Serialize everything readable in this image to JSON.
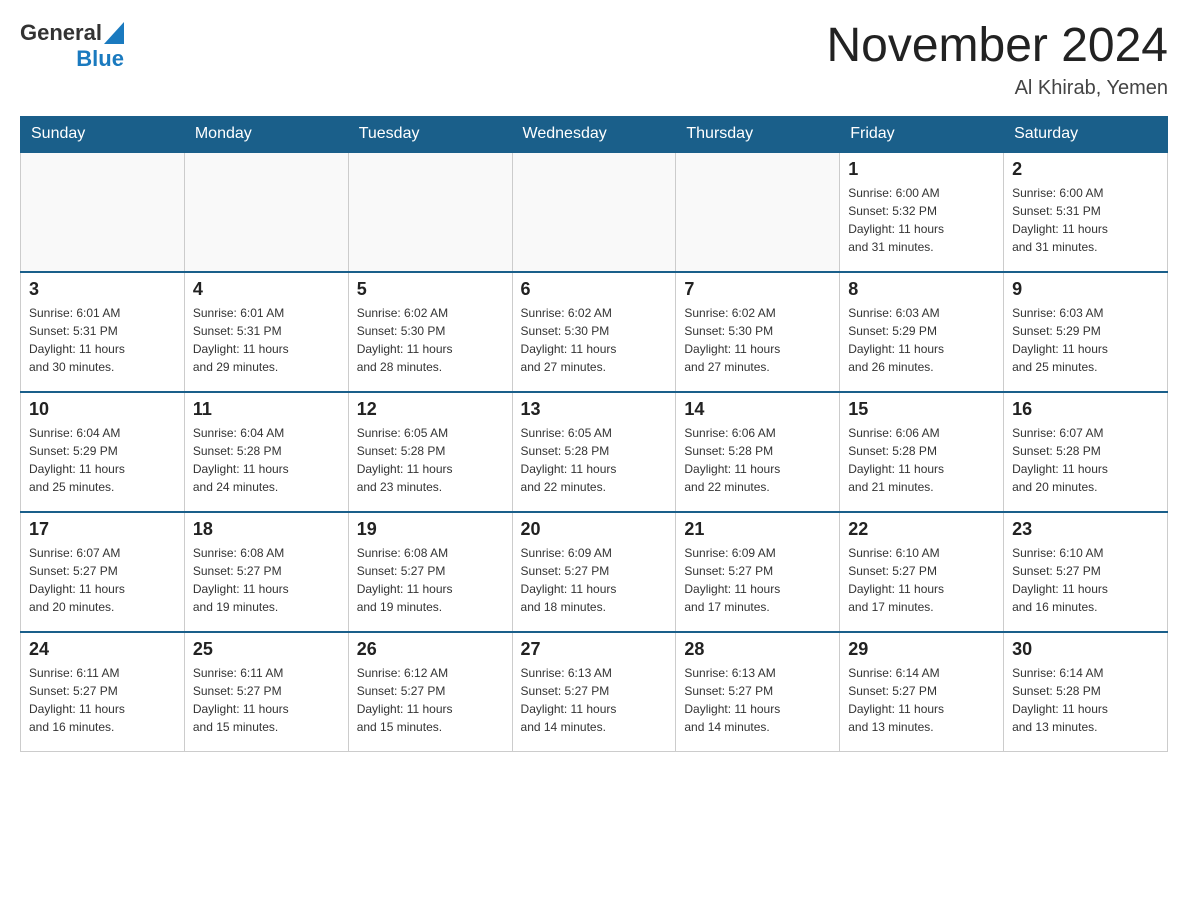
{
  "header": {
    "logo_general": "General",
    "logo_blue": "Blue",
    "title": "November 2024",
    "subtitle": "Al Khirab, Yemen"
  },
  "weekdays": [
    "Sunday",
    "Monday",
    "Tuesday",
    "Wednesday",
    "Thursday",
    "Friday",
    "Saturday"
  ],
  "weeks": [
    [
      {
        "day": "",
        "info": ""
      },
      {
        "day": "",
        "info": ""
      },
      {
        "day": "",
        "info": ""
      },
      {
        "day": "",
        "info": ""
      },
      {
        "day": "",
        "info": ""
      },
      {
        "day": "1",
        "info": "Sunrise: 6:00 AM\nSunset: 5:32 PM\nDaylight: 11 hours\nand 31 minutes."
      },
      {
        "day": "2",
        "info": "Sunrise: 6:00 AM\nSunset: 5:31 PM\nDaylight: 11 hours\nand 31 minutes."
      }
    ],
    [
      {
        "day": "3",
        "info": "Sunrise: 6:01 AM\nSunset: 5:31 PM\nDaylight: 11 hours\nand 30 minutes."
      },
      {
        "day": "4",
        "info": "Sunrise: 6:01 AM\nSunset: 5:31 PM\nDaylight: 11 hours\nand 29 minutes."
      },
      {
        "day": "5",
        "info": "Sunrise: 6:02 AM\nSunset: 5:30 PM\nDaylight: 11 hours\nand 28 minutes."
      },
      {
        "day": "6",
        "info": "Sunrise: 6:02 AM\nSunset: 5:30 PM\nDaylight: 11 hours\nand 27 minutes."
      },
      {
        "day": "7",
        "info": "Sunrise: 6:02 AM\nSunset: 5:30 PM\nDaylight: 11 hours\nand 27 minutes."
      },
      {
        "day": "8",
        "info": "Sunrise: 6:03 AM\nSunset: 5:29 PM\nDaylight: 11 hours\nand 26 minutes."
      },
      {
        "day": "9",
        "info": "Sunrise: 6:03 AM\nSunset: 5:29 PM\nDaylight: 11 hours\nand 25 minutes."
      }
    ],
    [
      {
        "day": "10",
        "info": "Sunrise: 6:04 AM\nSunset: 5:29 PM\nDaylight: 11 hours\nand 25 minutes."
      },
      {
        "day": "11",
        "info": "Sunrise: 6:04 AM\nSunset: 5:28 PM\nDaylight: 11 hours\nand 24 minutes."
      },
      {
        "day": "12",
        "info": "Sunrise: 6:05 AM\nSunset: 5:28 PM\nDaylight: 11 hours\nand 23 minutes."
      },
      {
        "day": "13",
        "info": "Sunrise: 6:05 AM\nSunset: 5:28 PM\nDaylight: 11 hours\nand 22 minutes."
      },
      {
        "day": "14",
        "info": "Sunrise: 6:06 AM\nSunset: 5:28 PM\nDaylight: 11 hours\nand 22 minutes."
      },
      {
        "day": "15",
        "info": "Sunrise: 6:06 AM\nSunset: 5:28 PM\nDaylight: 11 hours\nand 21 minutes."
      },
      {
        "day": "16",
        "info": "Sunrise: 6:07 AM\nSunset: 5:28 PM\nDaylight: 11 hours\nand 20 minutes."
      }
    ],
    [
      {
        "day": "17",
        "info": "Sunrise: 6:07 AM\nSunset: 5:27 PM\nDaylight: 11 hours\nand 20 minutes."
      },
      {
        "day": "18",
        "info": "Sunrise: 6:08 AM\nSunset: 5:27 PM\nDaylight: 11 hours\nand 19 minutes."
      },
      {
        "day": "19",
        "info": "Sunrise: 6:08 AM\nSunset: 5:27 PM\nDaylight: 11 hours\nand 19 minutes."
      },
      {
        "day": "20",
        "info": "Sunrise: 6:09 AM\nSunset: 5:27 PM\nDaylight: 11 hours\nand 18 minutes."
      },
      {
        "day": "21",
        "info": "Sunrise: 6:09 AM\nSunset: 5:27 PM\nDaylight: 11 hours\nand 17 minutes."
      },
      {
        "day": "22",
        "info": "Sunrise: 6:10 AM\nSunset: 5:27 PM\nDaylight: 11 hours\nand 17 minutes."
      },
      {
        "day": "23",
        "info": "Sunrise: 6:10 AM\nSunset: 5:27 PM\nDaylight: 11 hours\nand 16 minutes."
      }
    ],
    [
      {
        "day": "24",
        "info": "Sunrise: 6:11 AM\nSunset: 5:27 PM\nDaylight: 11 hours\nand 16 minutes."
      },
      {
        "day": "25",
        "info": "Sunrise: 6:11 AM\nSunset: 5:27 PM\nDaylight: 11 hours\nand 15 minutes."
      },
      {
        "day": "26",
        "info": "Sunrise: 6:12 AM\nSunset: 5:27 PM\nDaylight: 11 hours\nand 15 minutes."
      },
      {
        "day": "27",
        "info": "Sunrise: 6:13 AM\nSunset: 5:27 PM\nDaylight: 11 hours\nand 14 minutes."
      },
      {
        "day": "28",
        "info": "Sunrise: 6:13 AM\nSunset: 5:27 PM\nDaylight: 11 hours\nand 14 minutes."
      },
      {
        "day": "29",
        "info": "Sunrise: 6:14 AM\nSunset: 5:27 PM\nDaylight: 11 hours\nand 13 minutes."
      },
      {
        "day": "30",
        "info": "Sunrise: 6:14 AM\nSunset: 5:28 PM\nDaylight: 11 hours\nand 13 minutes."
      }
    ]
  ]
}
